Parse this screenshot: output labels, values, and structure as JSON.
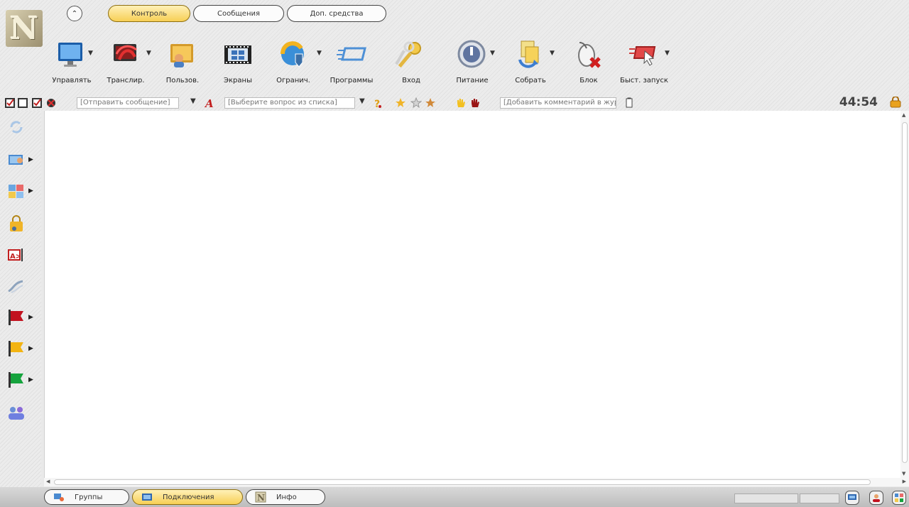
{
  "header": {
    "tabs": [
      {
        "label": "Контроль",
        "active": true
      },
      {
        "label": "Сообщения",
        "active": false
      },
      {
        "label": "Доп. средства",
        "active": false
      }
    ]
  },
  "ribbon": {
    "buttons": [
      {
        "label": "Управлять",
        "icon": "monitor-icon",
        "dropdown": true
      },
      {
        "label": "Транслир.",
        "icon": "broadcast-icon",
        "dropdown": true
      },
      {
        "label": "Пользов.",
        "icon": "user-icon",
        "dropdown": false
      },
      {
        "label": "Экраны",
        "icon": "film-icon",
        "dropdown": false
      },
      {
        "label": "Огранич.",
        "icon": "browser-shield-icon",
        "dropdown": true
      },
      {
        "label": "Программы",
        "icon": "programs-icon",
        "dropdown": false
      },
      {
        "label": "Вход",
        "icon": "keys-icon",
        "dropdown": false
      },
      {
        "label": "Питание",
        "icon": "power-icon",
        "dropdown": true
      },
      {
        "label": "Собрать",
        "icon": "collect-icon",
        "dropdown": true
      },
      {
        "label": "Блок",
        "icon": "mouse-block-icon",
        "dropdown": false
      },
      {
        "label": "Быст. запуск",
        "icon": "quick-launch-icon",
        "dropdown": true
      }
    ]
  },
  "toolbar": {
    "message_placeholder": "[Отправить сообщение]",
    "question_placeholder": "[Выберите вопрос из списка]",
    "comment_placeholder": "[Добавить комментарий в журнал]",
    "timer": "44:54"
  },
  "bottom": {
    "tabs": [
      {
        "label": "Группы",
        "active": false
      },
      {
        "label": "Подключения",
        "active": true
      },
      {
        "label": "Инфо",
        "active": false
      }
    ]
  }
}
